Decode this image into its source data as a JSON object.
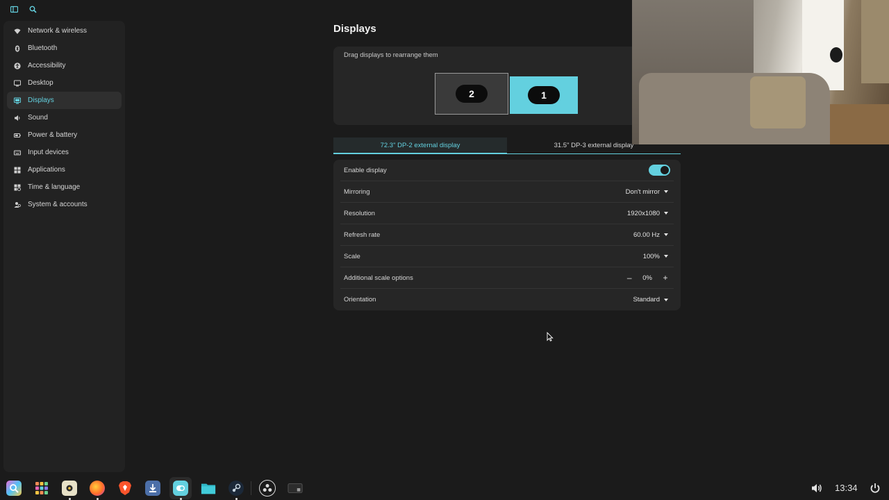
{
  "page": {
    "title": "Displays"
  },
  "sidebar": {
    "items": [
      {
        "label": "Network & wireless",
        "icon": "wifi-icon"
      },
      {
        "label": "Bluetooth",
        "icon": "bluetooth-icon"
      },
      {
        "label": "Accessibility",
        "icon": "accessibility-icon"
      },
      {
        "label": "Desktop",
        "icon": "desktop-icon"
      },
      {
        "label": "Displays",
        "icon": "display-icon",
        "active": true
      },
      {
        "label": "Sound",
        "icon": "sound-icon"
      },
      {
        "label": "Power & battery",
        "icon": "battery-icon"
      },
      {
        "label": "Input devices",
        "icon": "keyboard-icon"
      },
      {
        "label": "Applications",
        "icon": "applications-icon"
      },
      {
        "label": "Time & language",
        "icon": "clock-icon"
      },
      {
        "label": "System & accounts",
        "icon": "accounts-icon"
      }
    ]
  },
  "arrange": {
    "hint": "Drag displays to rearrange them",
    "displays": [
      {
        "number": "2",
        "selected": false
      },
      {
        "number": "1",
        "selected": true
      }
    ]
  },
  "tabs": [
    {
      "label": "72.3\" DP-2 external display",
      "active": true
    },
    {
      "label": "31.5\" DP-3 external display",
      "active": false
    }
  ],
  "settings": {
    "enable_display": {
      "label": "Enable display",
      "enabled": true
    },
    "mirroring": {
      "label": "Mirroring",
      "value": "Don't mirror"
    },
    "resolution": {
      "label": "Resolution",
      "value": "1920x1080"
    },
    "refresh_rate": {
      "label": "Refresh rate",
      "value": "60.00 Hz"
    },
    "scale": {
      "label": "Scale",
      "value": "100%"
    },
    "additional_scale": {
      "label": "Additional scale options",
      "value": "0%",
      "minus": "–",
      "plus": "+"
    },
    "orientation": {
      "label": "Orientation",
      "value": "Standard"
    }
  },
  "taskbar": {
    "clock": "13:34",
    "apps": [
      "app-launcher",
      "app-grid",
      "store",
      "firefox",
      "brave",
      "downloader",
      "settings",
      "files",
      "steam",
      "obs",
      "terminal"
    ]
  },
  "colors": {
    "accent": "#63d0df",
    "background": "#1b1b1b",
    "card": "#262626"
  }
}
